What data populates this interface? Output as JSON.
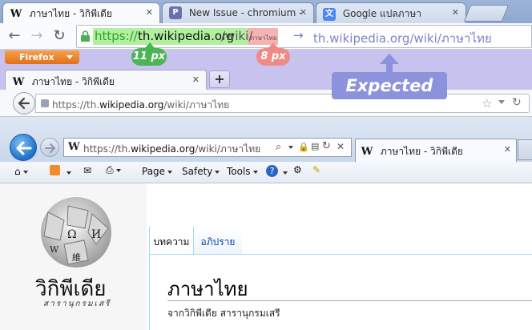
{
  "chrome": {
    "tabs": [
      {
        "label": "ภาษาไทย - วิกิพีเดีย",
        "favicon": "W"
      },
      {
        "label": "New Issue - chromium - A",
        "favicon": "P"
      },
      {
        "label": "Google แปลภาษา",
        "favicon": "google-translate-icon"
      }
    ],
    "url": {
      "scheme": "https://",
      "host": "th.wikipedia.org",
      "path": "/wiki/",
      "thai": "ภาษาไทย"
    },
    "expected_url": "th.wikipedia.org/wiki/ภาษาไทย",
    "expected_arrow": "→"
  },
  "annotations": {
    "callout_11": "11 px",
    "callout_8": "8 px",
    "expected_label": "Expected",
    "highlight_green": "#b2f0a0",
    "highlight_red": "#f6b3b3"
  },
  "firefox": {
    "menu_button": "Firefox",
    "tab_label": "ภาษาไทย - วิกิพีเดีย",
    "tab_favicon": "W",
    "new_tab": "+",
    "url_prefix": "https://th.",
    "url_host": "wikipedia.org",
    "url_rest": "/wiki/ภาษาไทย"
  },
  "ie": {
    "url_prefix": "https://th.",
    "url_host": "wikipedia.org",
    "url_rest": "/wiki/ภาษาไทย",
    "tab_label": "ภาษาไทย - วิกิพีเดีย",
    "tab_favicon": "W",
    "menus": {
      "page": "Page",
      "safety": "Safety",
      "tools": "Tools"
    }
  },
  "wiki": {
    "wordmark": "วิกิพีเดีย",
    "tagline": "สารานุกรมเสรี",
    "tab_article": "บทความ",
    "tab_talk": "อภิปราย",
    "title": "ภาษาไทย",
    "subtitle": "จากวิกิพีเดีย สารานุกรมเสรี"
  }
}
